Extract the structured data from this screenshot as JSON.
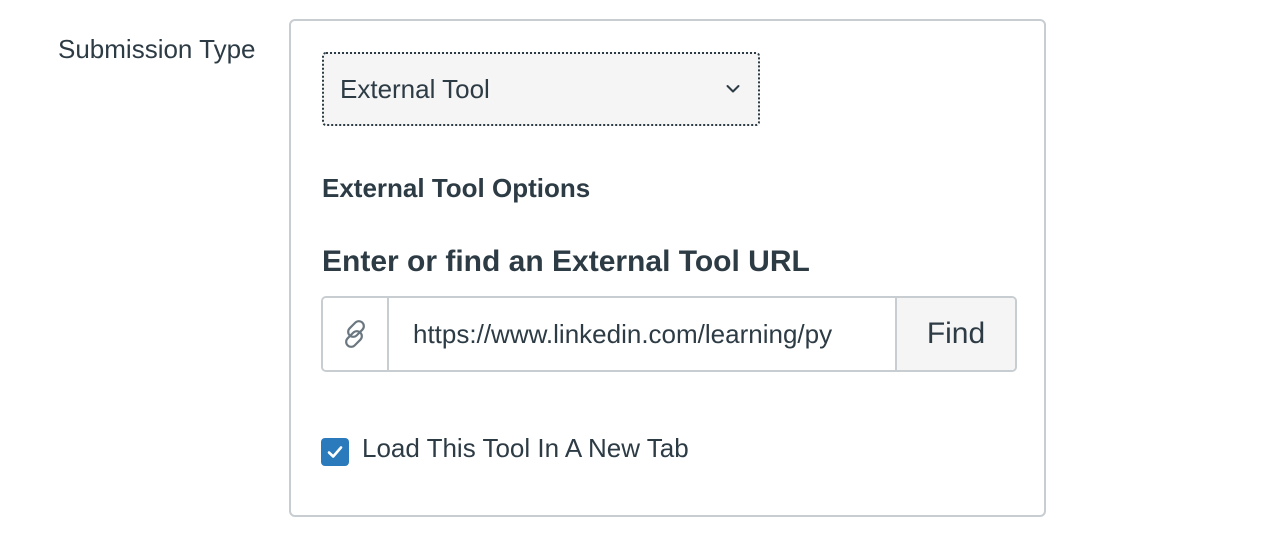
{
  "submission_type": {
    "label": "Submission Type",
    "selected": "External Tool"
  },
  "external_tool_options": {
    "heading": "External Tool Options",
    "url_heading": "Enter or find an External Tool URL",
    "url_value": "https://www.linkedin.com/learning/py",
    "find_label": "Find",
    "link_icon": "link-icon",
    "new_tab_label": "Load This Tool In A New Tab",
    "new_tab_checked": true
  },
  "colors": {
    "text": "#2d3b45",
    "border": "#c7cdd1",
    "checkbox": "#2b7abc",
    "button_bg": "#f5f5f5"
  }
}
